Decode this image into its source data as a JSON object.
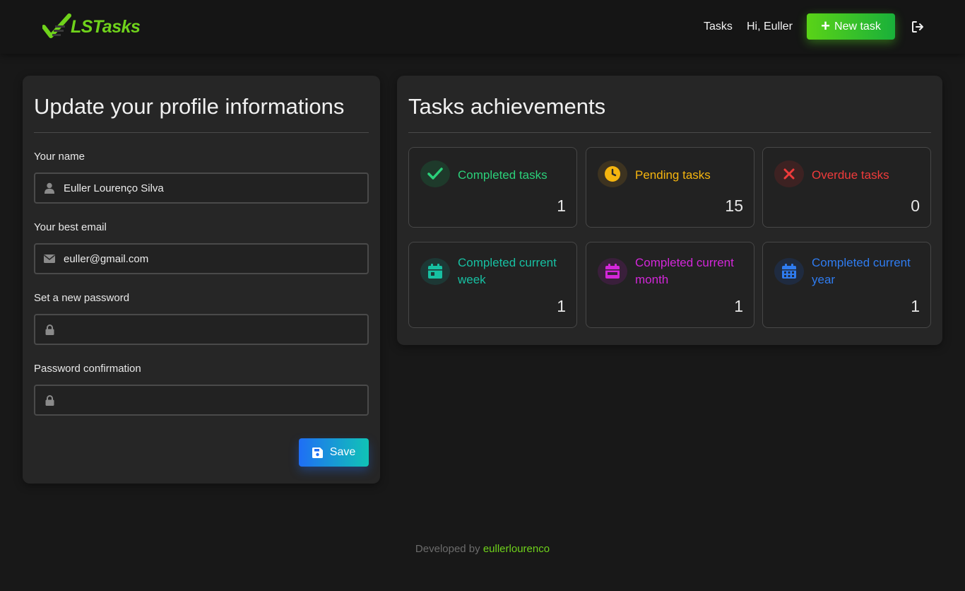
{
  "header": {
    "logo_text": "LSTasks",
    "nav_tasks": "Tasks",
    "greeting": "Hi, Euller",
    "new_task_label": "New task"
  },
  "profile": {
    "title": "Update your profile informations",
    "name_label": "Your name",
    "name_value": "Euller Lourenço Silva",
    "email_label": "Your best email",
    "email_value": "euller@gmail.com",
    "password_label": "Set a new password",
    "password_value": "",
    "confirm_label": "Password confirmation",
    "confirm_value": "",
    "save_label": "Save"
  },
  "achievements": {
    "title": "Tasks achievements",
    "stats": [
      {
        "label": "Completed tasks",
        "value": "1",
        "color": "#2bd07a",
        "icon": "check-icon"
      },
      {
        "label": "Pending tasks",
        "value": "15",
        "color": "#f5b50f",
        "icon": "clock-icon"
      },
      {
        "label": "Overdue tasks",
        "value": "0",
        "color": "#ef3b3b",
        "icon": "close-icon"
      },
      {
        "label": "Completed current week",
        "value": "1",
        "color": "#17c0a2",
        "icon": "calendar-icon"
      },
      {
        "label": "Completed current month",
        "value": "1",
        "color": "#d327d9",
        "icon": "calendar-alt-icon"
      },
      {
        "label": "Completed current year",
        "value": "1",
        "color": "#2f7cf0",
        "icon": "calendar-grid-icon"
      }
    ]
  },
  "footer": {
    "prefix": "Developed by ",
    "author": "eullerlourenco"
  },
  "colors": {
    "brand_green": "#6fd21b",
    "save_blue": "#1f6ef5",
    "save_teal": "#10c4b6"
  }
}
